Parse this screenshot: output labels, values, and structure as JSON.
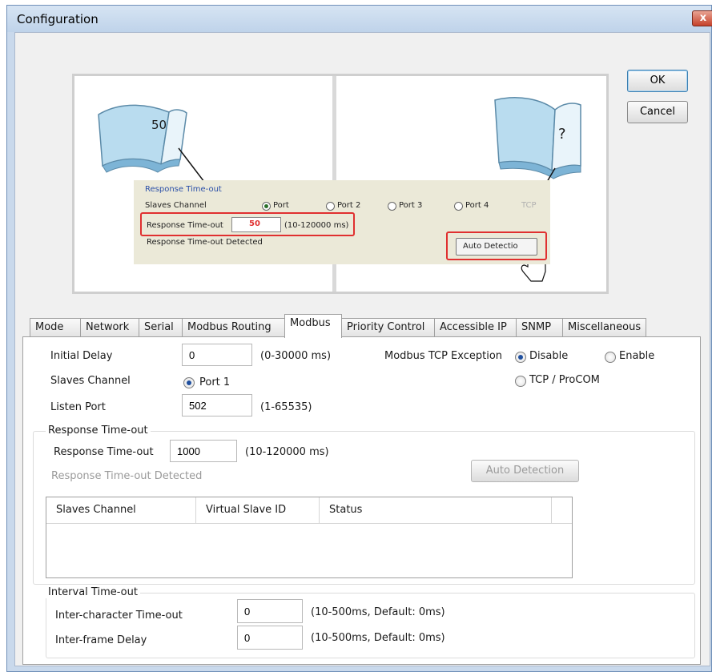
{
  "window": {
    "title": "Configuration",
    "close_label": "x"
  },
  "buttons": {
    "ok": "OK",
    "cancel": "Cancel",
    "auto_detection": "Auto Detection"
  },
  "illustration": {
    "book_left_text": "50",
    "book_right_text": "?",
    "group_title": "Response Time-out",
    "slaves_channel": "Slaves Channel",
    "ports": [
      "Port",
      "Port 2",
      "Port 3",
      "Port 4",
      "TCP"
    ],
    "response_timeout_label": "Response Time-out",
    "response_timeout_value": "50",
    "range": "(10-120000 ms)",
    "detected": "Response Time-out Detected",
    "auto_detection": "Auto Detectio"
  },
  "tabs": [
    "Mode",
    "Network",
    "Serial",
    "Modbus Routing",
    "Modbus",
    "Priority Control",
    "Accessible IP",
    "SNMP",
    "Miscellaneous"
  ],
  "active_tab": "Modbus",
  "form": {
    "initial_delay_label": "Initial Delay",
    "initial_delay_value": "0",
    "initial_delay_range": "(0-30000 ms)",
    "slaves_channel_label": "Slaves Channel",
    "slaves_channel_option": "Port 1",
    "listen_port_label": "Listen Port",
    "listen_port_value": "502",
    "listen_port_range": "(1-65535)",
    "tcp_exception_label": "Modbus TCP Exception",
    "exception_disable": "Disable",
    "exception_enable": "Enable",
    "exception_tcp_procom": "TCP / ProCOM"
  },
  "response_group": {
    "title": "Response Time-out",
    "timeout_label": "Response Time-out",
    "timeout_value": "1000",
    "timeout_range": "(10-120000 ms)",
    "detected_label": "Response Time-out Detected",
    "columns": [
      "Slaves Channel",
      "Virtual Slave ID",
      "Status"
    ]
  },
  "interval_group": {
    "title": "Interval Time-out",
    "inter_char_label": "Inter-character Time-out",
    "inter_char_value": "0",
    "inter_char_range": "(10-500ms, Default: 0ms)",
    "inter_frame_label": "Inter-frame Delay",
    "inter_frame_value": "0",
    "inter_frame_range": "(10-500ms, Default: 0ms)"
  }
}
